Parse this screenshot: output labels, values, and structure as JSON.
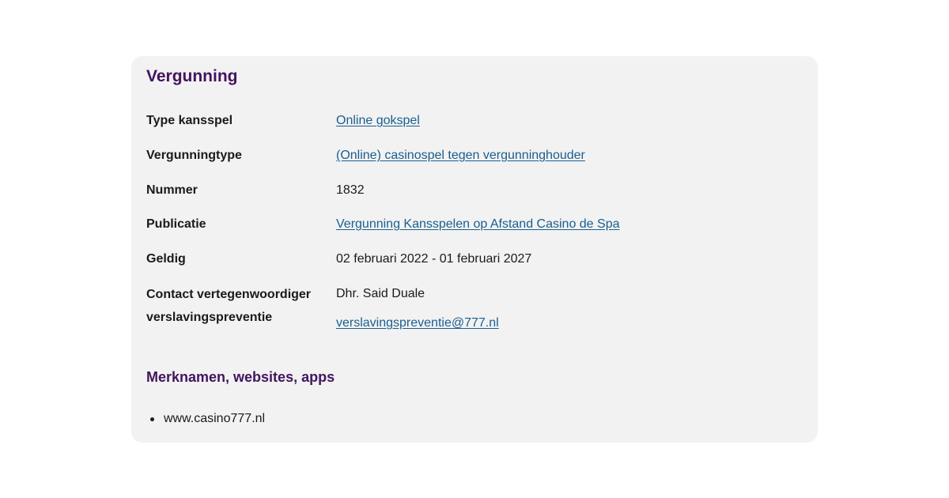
{
  "card": {
    "title": "Vergunning",
    "rows": [
      {
        "term": "Type kansspel",
        "value": "Online gokspel",
        "is_link": true
      },
      {
        "term": "Vergunningtype",
        "value": "(Online) casinospel tegen vergunninghouder",
        "is_link": true
      },
      {
        "term": "Nummer",
        "value": "1832",
        "is_link": false
      },
      {
        "term": "Publicatie",
        "value": "Vergunning Kansspelen op Afstand Casino de Spa",
        "is_link": true
      },
      {
        "term": "Geldig",
        "value": "02 februari 2022 - 01 februari 2027",
        "is_link": false
      },
      {
        "term_line1": "Contact vertegenwoordiger",
        "term_line2": "verslavingspreventie",
        "value": "Dhr. Said Duale",
        "email": "verslavingspreventie@777.nl"
      }
    ],
    "brands": {
      "title": "Merknamen, websites, apps",
      "items": [
        "www.casino777.nl"
      ]
    }
  },
  "colors": {
    "heading": "#42145f",
    "link": "#1a5e8f",
    "card_background": "#f2f2f2",
    "text": "#1a1a1a"
  }
}
